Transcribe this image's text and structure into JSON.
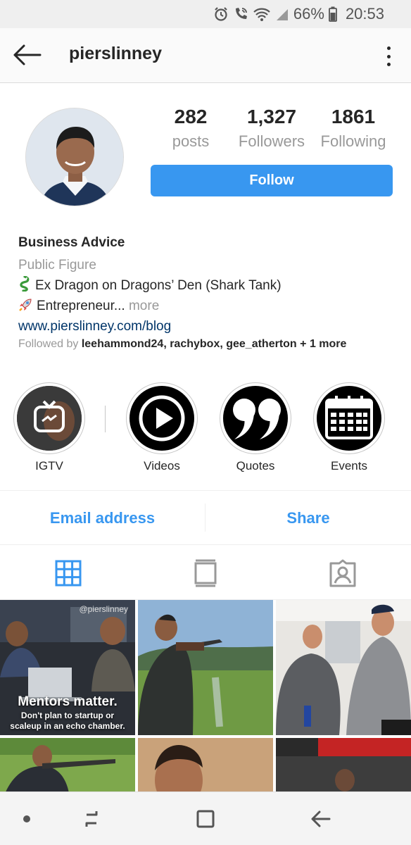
{
  "status_bar": {
    "battery_text": "66%",
    "time": "20:53",
    "icons": [
      "alarm-icon",
      "wifi-call-icon",
      "wifi-icon",
      "signal-icon",
      "battery-icon"
    ]
  },
  "header": {
    "username": "pierslinney",
    "back_icon": "arrow-left-icon",
    "menu_icon": "more-vertical-icon"
  },
  "profile": {
    "stats": [
      {
        "value": "282",
        "label": "posts"
      },
      {
        "value": "1,327",
        "label": "Followers"
      },
      {
        "value": "1861",
        "label": "Following"
      }
    ],
    "follow_label": "Follow",
    "bio": {
      "name": "Business Advice",
      "category": "Public Figure",
      "line1": "Ex Dragon on Dragons’ Den (Shark Tank)",
      "line2": "Entrepreneur...",
      "more": "more",
      "link": "www.pierslinney.com/blog"
    },
    "followed_by": {
      "prefix": "Followed by",
      "users": [
        "leehammond24",
        "rachybox",
        "gee_atherton"
      ],
      "suffix": "+ 1 more"
    }
  },
  "highlights": [
    {
      "label": "IGTV",
      "icon": "igtv-icon"
    },
    {
      "label": "Videos",
      "icon": "play-icon"
    },
    {
      "label": "Quotes",
      "icon": "quote-icon"
    },
    {
      "label": "Events",
      "icon": "calendar-icon"
    }
  ],
  "contact": {
    "email_label": "Email address",
    "share_label": "Share"
  },
  "tabs": [
    {
      "name": "grid",
      "icon": "grid-icon",
      "active": true
    },
    {
      "name": "feed",
      "icon": "feed-icon",
      "active": false
    },
    {
      "name": "tagged",
      "icon": "tagged-icon",
      "active": false
    }
  ],
  "posts": {
    "first": {
      "watermark": "@pierslinney",
      "headline": "Mentors matter.",
      "subline1": "Don't plan to startup or",
      "subline2": "scaleup in an echo chamber."
    }
  },
  "colors": {
    "accent": "#3897f0",
    "link": "#003569",
    "muted": "#999999"
  }
}
